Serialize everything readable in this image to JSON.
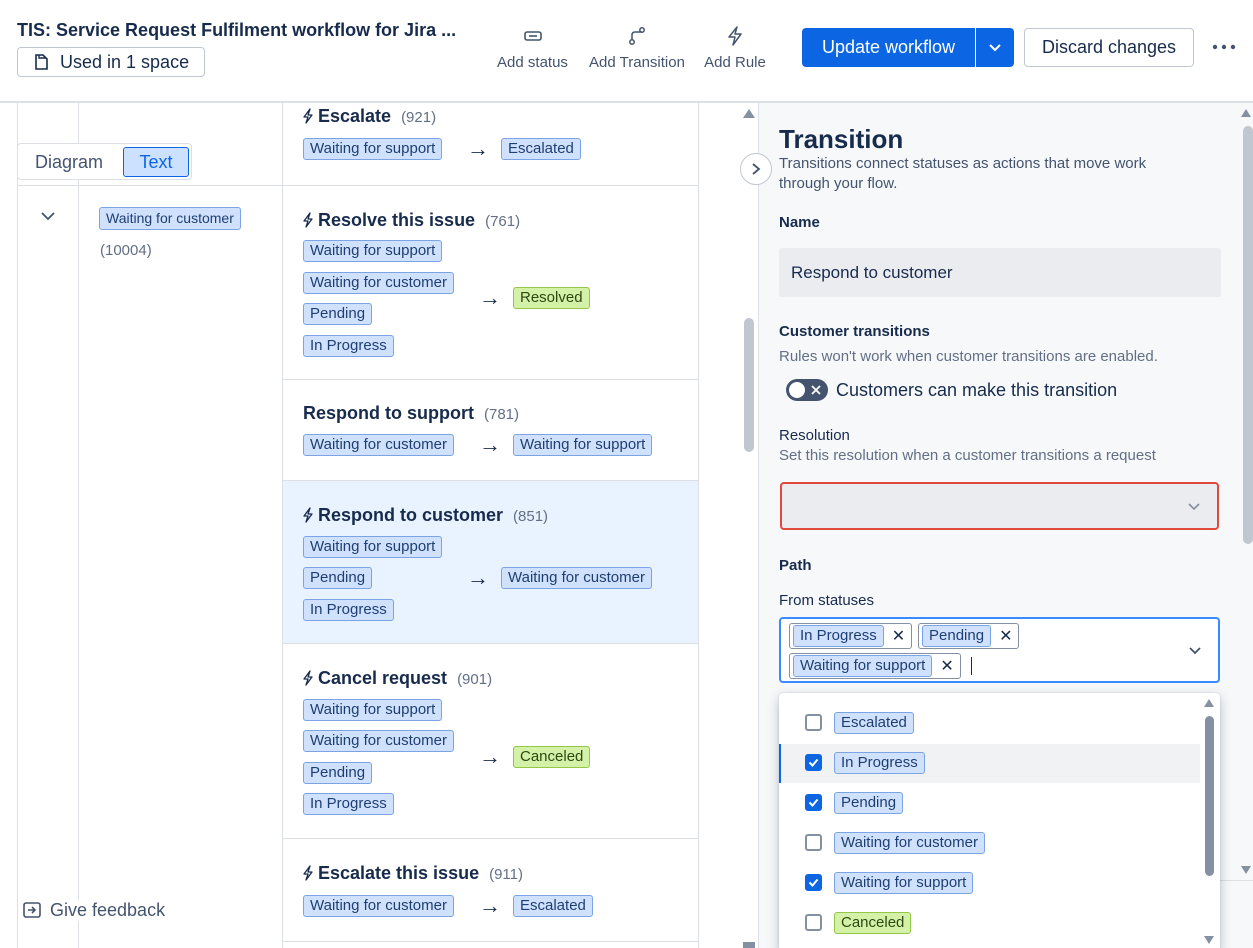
{
  "header": {
    "title": "TIS: Service Request Fulfilment workflow for Jira ...",
    "usage_label": "Used in 1 space",
    "add_status": "Add status",
    "add_transition": "Add Transition",
    "add_rule": "Add Rule",
    "update_button": "Update workflow",
    "discard_button": "Discard changes",
    "more": "⋯"
  },
  "view_toggle": {
    "diagram": "Diagram",
    "text": "Text"
  },
  "status_row": {
    "status": "Waiting for customer",
    "id": "(10004)"
  },
  "transitions": [
    {
      "name": "Escalate",
      "count": "(921)",
      "from": [
        "Waiting for support"
      ],
      "to": "Escalated"
    },
    {
      "name": "Resolve this issue",
      "count": "(761)",
      "from": [
        "Waiting for support",
        "Waiting for customer",
        "Pending",
        "In Progress"
      ],
      "to": "Resolved"
    },
    {
      "name": "Respond to support",
      "count": "(781)",
      "from": [
        "Waiting for customer"
      ],
      "to": "Waiting for support"
    },
    {
      "name": "Respond to customer",
      "count": "(851)",
      "from": [
        "Waiting for support",
        "Pending",
        "In Progress"
      ],
      "to": "Waiting for customer"
    },
    {
      "name": "Cancel request",
      "count": "(901)",
      "from": [
        "Waiting for support",
        "Waiting for customer",
        "Pending",
        "In Progress"
      ],
      "to": "Canceled"
    },
    {
      "name": "Escalate this issue",
      "count": "(911)",
      "from": [
        "Waiting for customer"
      ],
      "to": "Escalated"
    }
  ],
  "feedback": "Give feedback",
  "panel": {
    "title": "Transition",
    "description": "Transitions connect statuses as actions that move work through your flow.",
    "name_label": "Name",
    "name_value": "Respond to customer",
    "customer_heading": "Customer transitions",
    "customer_note": "Rules won't work when customer transitions are enabled.",
    "customer_toggle_label": "Customers can make this transition",
    "resolution_label": "Resolution",
    "resolution_note": "Set this resolution when a customer transitions a request",
    "path_heading": "Path",
    "from_label": "From statuses",
    "selected": [
      "In Progress",
      "Pending",
      "Waiting for support"
    ]
  },
  "dropdown": [
    {
      "label": "Escalated",
      "checked": false
    },
    {
      "label": "In Progress",
      "checked": true
    },
    {
      "label": "Pending",
      "checked": true
    },
    {
      "label": "Waiting for customer",
      "checked": false
    },
    {
      "label": "Waiting for support",
      "checked": true
    },
    {
      "label": "Canceled",
      "checked": false
    }
  ],
  "colors": {
    "primary": "#0c66e4",
    "lozenge_blue": "#cfe1fd",
    "lozenge_green": "#d3f1a7",
    "error_border": "#e2483d",
    "selected_row": "#e9f2ff"
  }
}
